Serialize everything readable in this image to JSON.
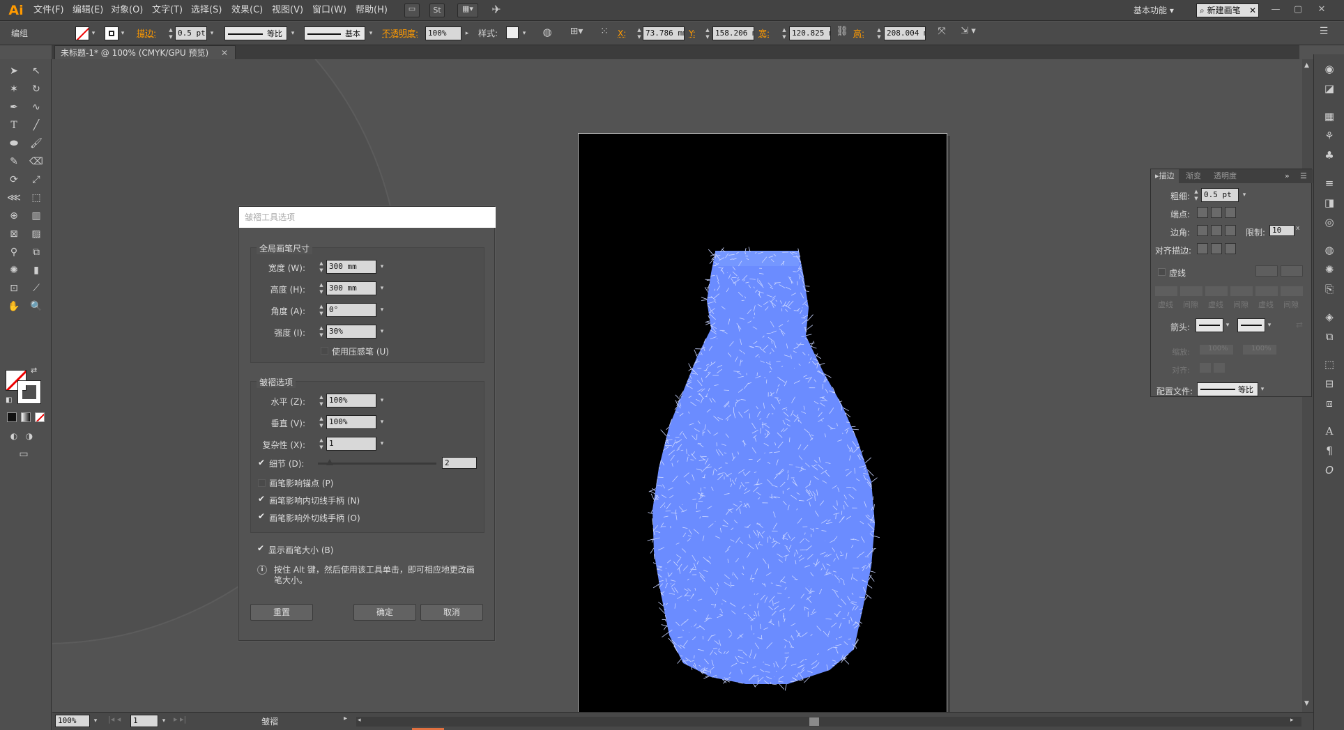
{
  "app": {
    "logo": "Ai"
  },
  "menu": [
    {
      "id": "file",
      "label": "文件(F)"
    },
    {
      "id": "edit",
      "label": "编辑(E)"
    },
    {
      "id": "object",
      "label": "对象(O)"
    },
    {
      "id": "type",
      "label": "文字(T)"
    },
    {
      "id": "select",
      "label": "选择(S)"
    },
    {
      "id": "effect",
      "label": "效果(C)"
    },
    {
      "id": "view",
      "label": "视图(V)"
    },
    {
      "id": "window",
      "label": "窗口(W)"
    },
    {
      "id": "help",
      "label": "帮助(H)"
    }
  ],
  "topright": {
    "workspace": "基本功能",
    "search": "新建画笔"
  },
  "control": {
    "selection": "编组",
    "stroke_label": "描边:",
    "stroke_value": "0.5 pt",
    "profile": "等比",
    "brush": "基本",
    "opacity_label": "不透明度:",
    "opacity_value": "100%",
    "style_label": "样式:",
    "x_label": "X:",
    "x_value": "73.786 mm",
    "y_label": "Y:",
    "y_value": "158.206 m",
    "w_label": "宽:",
    "w_value": "120.825 m",
    "h_label": "高:",
    "h_value": "208.004 m"
  },
  "doc_tab": {
    "title": "未标题-1* @ 100% (CMYK/GPU 预览)"
  },
  "dialog": {
    "title": "皱褶工具选项",
    "global_title": "全局画笔尺寸",
    "width_label": "宽度 (W):",
    "width_value": "300 mm",
    "height_label": "高度 (H):",
    "height_value": "300 mm",
    "angle_label": "角度 (A):",
    "angle_value": "0°",
    "intensity_label": "强度 (I):",
    "intensity_value": "30%",
    "pressure_label": "使用压感笔 (U)",
    "options_title": "皱褶选项",
    "horizontal_label": "水平 (Z):",
    "horizontal_value": "100%",
    "vertical_label": "垂直 (V):",
    "vertical_value": "100%",
    "complexity_label": "复杂性 (X):",
    "complexity_value": "1",
    "detail_label": "细节 (D):",
    "detail_value": "2",
    "detail_level": 0.1,
    "anchor_label": "画笔影响锚点 (P)",
    "in_handle_label": "画笔影响内切线手柄 (N)",
    "out_handle_label": "画笔影响外切线手柄 (O)",
    "show_size_label": "显示画笔大小 (B)",
    "info_text": "按住 Alt 键，然后使用该工具单击，即可相应地更改画笔大小。",
    "reset_label": "重置",
    "ok_label": "确定",
    "cancel_label": "取消"
  },
  "stroke_panel": {
    "tabs": [
      "描边",
      "渐变",
      "透明度"
    ],
    "weight_label": "粗细:",
    "weight_value": "0.5 pt",
    "cap_label": "端点:",
    "corner_label": "边角:",
    "limit_label": "限制:",
    "limit_value": "10",
    "align_label": "对齐描边:",
    "dashed_label": "虚线",
    "dash_labels": [
      "虚线",
      "间隙",
      "虚线",
      "间隙",
      "虚线",
      "间隙"
    ],
    "arrow_label": "箭头:",
    "scale_label": "缩放:",
    "scale_a": "100%",
    "scale_b": "100%",
    "align_arrow_label": "对齐:",
    "profile_label": "配置文件:",
    "profile_value": "等比"
  },
  "status": {
    "zoom": "100%",
    "page": "1",
    "tool": "皱褶"
  },
  "colors": {
    "vase": "#6b8cff",
    "accent": "#ff9a00",
    "artboard": "#000000"
  }
}
